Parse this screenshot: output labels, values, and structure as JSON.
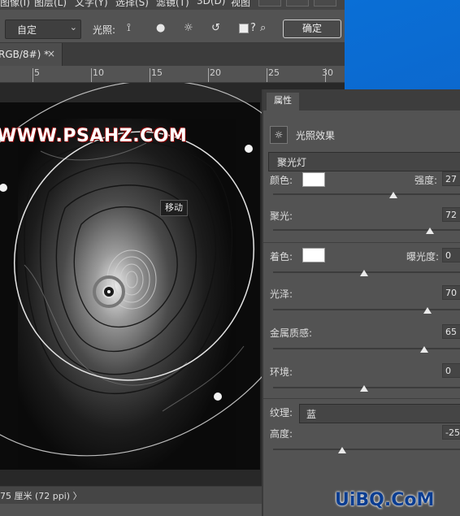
{
  "menubar": {
    "items": [
      "图像(I)",
      "图层(L)",
      "文字(Y)",
      "选择(S)",
      "滤镜(T)",
      "3D(D)",
      "视图"
    ]
  },
  "options": {
    "preset": "自定",
    "light_label": "光照:",
    "ok_label": "确定",
    "icons": [
      "spot-light-icon",
      "point-light-icon",
      "infinite-light-icon",
      "reset-icon",
      "checkbox",
      "help-icon",
      "search-icon"
    ]
  },
  "document": {
    "tab_title": "RGB/8#) *",
    "close_label": "×"
  },
  "ruler": {
    "labels": [
      "5",
      "10",
      "15",
      "20",
      "25",
      "30"
    ]
  },
  "canvas": {
    "watermark": "WWW.PSAHZ.COM",
    "tooltip": "移动"
  },
  "status": {
    "text": "75 厘米 (72 ppi)  〉"
  },
  "panel": {
    "tab": "属性",
    "effect_label": "光照效果",
    "light_type": "聚光灯",
    "color_label": "颜色:",
    "intensity_label": "强度:",
    "intensity_value": "27",
    "intensity_pct": 0.66,
    "hotspot_label": "聚光:",
    "hotspot_value": "72",
    "hotspot_pct": 0.86,
    "colorize_label": "着色:",
    "exposure_label": "曝光度:",
    "exposure_value": "0",
    "exposure_pct": 0.5,
    "gloss_label": "光泽:",
    "gloss_value": "70",
    "gloss_pct": 0.85,
    "metallic_label": "金属质感:",
    "metallic_value": "65",
    "metallic_pct": 0.83,
    "ambience_label": "环境:",
    "ambience_value": "0",
    "ambience_pct": 0.5,
    "texture_label": "纹理:",
    "texture_value": "蓝",
    "height_label": "高度:",
    "height_value": "-25",
    "height_pct": 0.38
  },
  "site_mark": "UiBQ.CoM",
  "colors": {
    "panel_bg": "#535353",
    "desktop": "#0a64c8",
    "swatch": "#ffffff"
  }
}
